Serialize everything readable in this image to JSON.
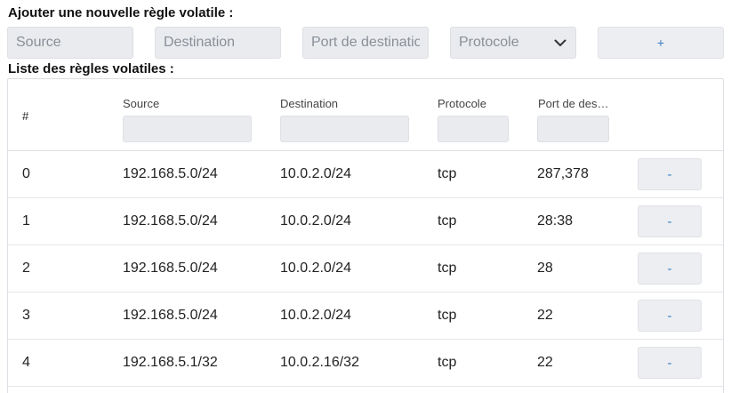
{
  "add_rule": {
    "title": "Ajouter une nouvelle règle volatile :",
    "source_placeholder": "Source",
    "destination_placeholder": "Destination",
    "port_placeholder": "Port de destination",
    "protocol_placeholder": "Protocole",
    "add_label": "+"
  },
  "list": {
    "title": "Liste des règles volatiles :",
    "headers": {
      "index": "#",
      "source": "Source",
      "destination": "Destination",
      "protocol": "Protocole",
      "port": "Port de destination"
    },
    "remove_label": "-",
    "rows": [
      {
        "index": "0",
        "source": "192.168.5.0/24",
        "destination": "10.0.2.0/24",
        "protocol": "tcp",
        "port": "287,378"
      },
      {
        "index": "1",
        "source": "192.168.5.0/24",
        "destination": "10.0.2.0/24",
        "protocol": "tcp",
        "port": "28:38"
      },
      {
        "index": "2",
        "source": "192.168.5.0/24",
        "destination": "10.0.2.0/24",
        "protocol": "tcp",
        "port": "28"
      },
      {
        "index": "3",
        "source": "192.168.5.0/24",
        "destination": "10.0.2.0/24",
        "protocol": "tcp",
        "port": "22"
      },
      {
        "index": "4",
        "source": "192.168.5.1/32",
        "destination": "10.0.2.16/32",
        "protocol": "tcp",
        "port": "22"
      }
    ]
  },
  "colors": {
    "accent": "#3b7fc4",
    "input_bg": "#e9ebee",
    "border": "#dcdfe3"
  },
  "icons": {
    "select_chevron": "chevron-down-icon"
  }
}
